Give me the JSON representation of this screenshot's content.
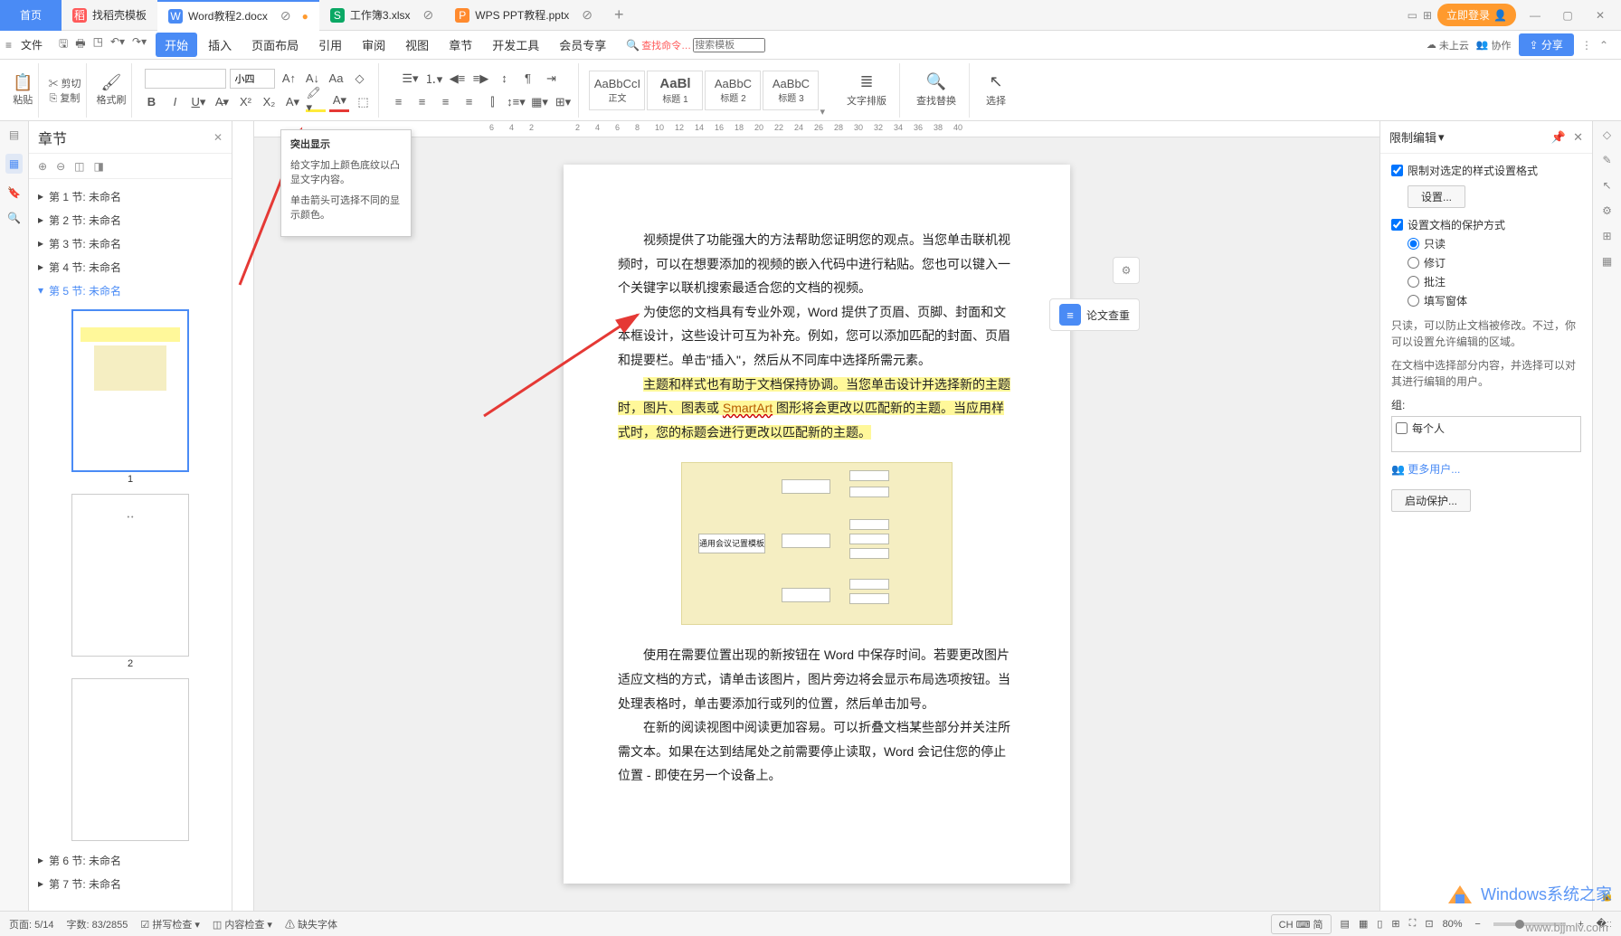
{
  "titlebar": {
    "home": "首页",
    "tabs": [
      {
        "icon": "稻",
        "iconBg": "#ff5a5a",
        "label": "找稻壳模板"
      },
      {
        "icon": "W",
        "iconBg": "#4a8bf5",
        "label": "Word教程2.docx",
        "active": true,
        "dirty": "●"
      },
      {
        "icon": "S",
        "iconBg": "#0aa864",
        "label": "工作簿3.xlsx"
      },
      {
        "icon": "P",
        "iconBg": "#ff8a2e",
        "label": "WPS PPT教程.pptx"
      }
    ],
    "login": "立即登录",
    "grid1": "⊞",
    "grid2": "⊟"
  },
  "menubar": {
    "file": "文件",
    "items": [
      "开始",
      "插入",
      "页面布局",
      "引用",
      "审阅",
      "视图",
      "章节",
      "开发工具",
      "会员专享"
    ],
    "searchCmdIcon": "Q",
    "searchCmd": "查找命令…",
    "searchTpl": "搜索模板",
    "cloud": "未上云",
    "coop": "协作",
    "share": "分享"
  },
  "ribbon": {
    "paste": "粘贴",
    "cut": "剪切",
    "copy": "复制",
    "brush": "格式刷",
    "fontName": "",
    "fontSize": "小四",
    "styles": [
      {
        "preview": "AaBbCcI",
        "name": "正文"
      },
      {
        "preview": "AaBl",
        "name": "标题 1",
        "cls": "heading1"
      },
      {
        "preview": "AaBbC",
        "name": "标题 2"
      },
      {
        "preview": "AaBbC",
        "name": "标题 3"
      }
    ],
    "textDir": "文字排版",
    "findRep": "查找替换",
    "select": "选择"
  },
  "tooltip": {
    "title": "突出显示",
    "l1": "给文字加上颜色底纹以凸显文字内容。",
    "l2": "单击箭头可选择不同的显示颜色。"
  },
  "chapter": {
    "title": "章节",
    "items": [
      "第 1 节: 未命名",
      "第 2 节: 未命名",
      "第 3 节: 未命名",
      "第 4 节: 未命名",
      "第 5 节: 未命名"
    ],
    "itemsAfter": [
      "第 6 节: 未命名",
      "第 7 节: 未命名"
    ],
    "thumbNums": [
      "1",
      "2"
    ]
  },
  "ruler": [
    "6",
    "4",
    "2",
    "2",
    "4",
    "6",
    "8",
    "10",
    "12",
    "14",
    "16",
    "18",
    "20",
    "22",
    "24",
    "26",
    "28",
    "30",
    "32",
    "34",
    "36",
    "38",
    "40"
  ],
  "doc": {
    "p1": "视频提供了功能强大的方法帮助您证明您的观点。当您单击联机视频时，可以在想要添加的视频的嵌入代码中进行粘贴。您也可以键入一个关键字以联机搜索最适合您的文档的视频。",
    "p2a": "为使您的文档具有专业外观，Word 提供了页眉、页脚、封面和文本框设计，这些设计可互为补充。例如，您可以添加匹配的封面、页眉和提要栏。单击\"插入\"，然后从不同库中选择所需元素。",
    "p3a": "主题和样式也有助于文档保持协调。当您单击设计并选择新的主题时，图片、图表或 ",
    "p3b": "SmartArt",
    "p3c": " 图形将会更改以匹配新的主题。当应用样式时，您的标题会进行更改以匹配新的主题。",
    "diagramRoot": "通用会议记置模板",
    "p4": "使用在需要位置出现的新按钮在 Word 中保存时间。若要更改图片适应文档的方式，请单击该图片，图片旁边将会显示布局选项按钮。当处理表格时，单击要添加行或列的位置，然后单击加号。",
    "p5": "在新的阅读视图中阅读更加容易。可以折叠文档某些部分并关注所需文本。如果在达到结尾处之前需要停止读取，Word 会记住您的停止位置 - 即使在另一个设备上。"
  },
  "paperCheck": "论文查重",
  "restrict": {
    "title": "限制编辑",
    "chk1": "限制对选定的样式设置格式",
    "btn1": "设置...",
    "chk2": "设置文档的保护方式",
    "r1": "只读",
    "r2": "修订",
    "r3": "批注",
    "r4": "填写窗体",
    "hint1": "只读，可以防止文档被修改。不过，你可以设置允许编辑的区域。",
    "hint2": "在文档中选择部分内容，并选择可以对其进行编辑的用户。",
    "groupLabel": "组:",
    "everyone": "每个人",
    "moreUsers": "更多用户...",
    "startProtect": "启动保护..."
  },
  "status": {
    "page": "页面: 5/14",
    "words": "字数: 83/2855",
    "spell": "拼写检查",
    "content": "内容检查",
    "missing": "缺失字体",
    "ime": "CH ⌨ 简",
    "zoom": "80%"
  },
  "watermark": {
    "l1": "Windows系统之家",
    "l2": "www.bjjmlv.com"
  }
}
